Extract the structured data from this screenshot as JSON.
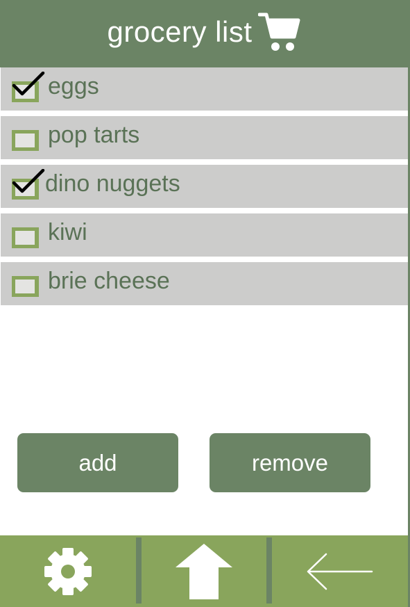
{
  "header": {
    "title": "grocery list",
    "icon": "shopping-cart-icon"
  },
  "items": [
    {
      "label": "eggs",
      "checked": true
    },
    {
      "label": "pop tarts",
      "checked": false
    },
    {
      "label": "dino nuggets",
      "checked": true
    },
    {
      "label": "kiwi",
      "checked": false
    },
    {
      "label": "brie cheese",
      "checked": false
    }
  ],
  "actions": {
    "add_label": "add",
    "remove_label": "remove"
  },
  "footer": {
    "icons": [
      "gear-icon",
      "home-up-arrow-icon",
      "back-arrow-icon"
    ]
  },
  "colors": {
    "primary": "#6b8465",
    "footer": "#89a55c",
    "row_bg": "#cccccb",
    "text": "#5a7256",
    "checkbox_border": "#89a55c",
    "checkbox_fill": "#e4e4e2"
  }
}
